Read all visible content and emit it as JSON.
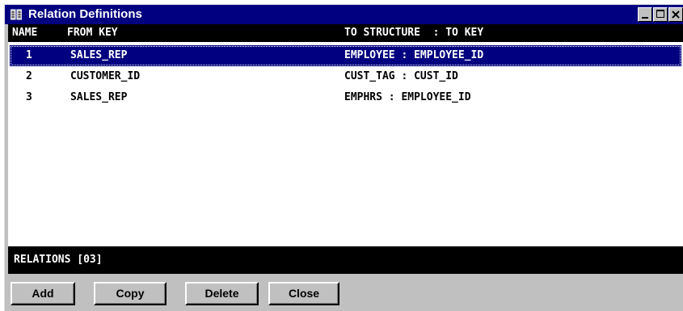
{
  "window": {
    "title": "Relation Definitions",
    "icon": "book-icon",
    "controls": [
      "minimize-icon",
      "maximize-icon",
      "close-icon"
    ]
  },
  "columns": {
    "name": "NAME",
    "from_key": "FROM KEY",
    "to": "TO STRUCTURE  : TO KEY"
  },
  "rows": [
    {
      "name": "1",
      "from_key": "SALES_REP",
      "to": "EMPLOYEE : EMPLOYEE_ID",
      "selected": true
    },
    {
      "name": "2",
      "from_key": "CUSTOMER_ID",
      "to": "CUST_TAG : CUST_ID",
      "selected": false
    },
    {
      "name": "3",
      "from_key": "SALES_REP",
      "to": "EMPHRS : EMPLOYEE_ID",
      "selected": false
    }
  ],
  "footer": {
    "status": "RELATIONS [03]"
  },
  "buttons": {
    "add": "Add",
    "copy": "Copy",
    "delete": "Delete",
    "close": "Close"
  },
  "colors": {
    "titlebar": "#000080",
    "selection": "#000080",
    "face": "#c0c0c0"
  }
}
